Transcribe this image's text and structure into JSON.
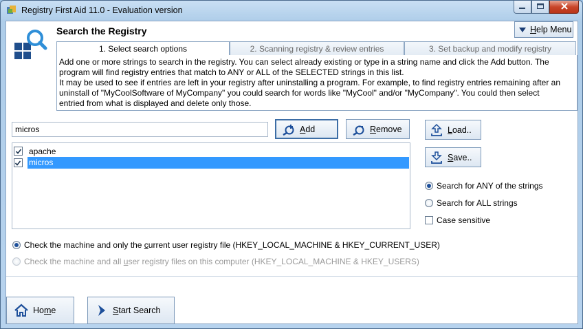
{
  "window": {
    "title": "Registry First Aid 11.0 - Evaluation version"
  },
  "header": {
    "title": "Search the Registry",
    "help_label": "Help Menu"
  },
  "tabs": [
    {
      "label": "1. Select search options"
    },
    {
      "label": "2. Scanning registry & review entries"
    },
    {
      "label": "3. Set backup and modify registry"
    }
  ],
  "description": {
    "lines": [
      "Add one or more strings to search in the registry. You can select already existing or type in a string name and click the Add button. The",
      "program will find registry entries that match to ANY or ALL of the SELECTED strings in this list.",
      "It may be used to see if entries are left in your registry after uninstalling a program. For example, to find registry entries remaining after an",
      "uninstall of \"MyCoolSoftware of MyCompany\" you could search for words like \"MyCool\" and/or \"MyCompany\". You could then select",
      "entried from what is displayed and delete only those."
    ]
  },
  "search": {
    "value": "micros"
  },
  "buttons": {
    "add": {
      "pre": "",
      "u": "A",
      "post": "dd"
    },
    "remove": {
      "pre": "",
      "u": "R",
      "post": "emove"
    },
    "load": {
      "pre": "",
      "u": "L",
      "post": "oad.."
    },
    "save": {
      "pre": "",
      "u": "S",
      "post": "ave.."
    },
    "home": {
      "pre": "Ho",
      "u": "m",
      "post": "e"
    },
    "start": {
      "pre": "",
      "u": "S",
      "post": "tart Search"
    }
  },
  "list": {
    "items": [
      {
        "label": "apache",
        "checked": true,
        "selected": false
      },
      {
        "label": "micros",
        "checked": true,
        "selected": true
      }
    ]
  },
  "options": {
    "any": "Search for ANY of the strings",
    "all": "Search for ALL strings",
    "case": "Case sensitive"
  },
  "scope": {
    "current": {
      "pre": "Check the machine and only the ",
      "u": "c",
      "post": "urrent user registry file (HKEY_LOCAL_MACHINE & HKEY_CURRENT_USER)"
    },
    "all": {
      "pre": "Check the machine and all ",
      "u": "u",
      "post": "ser registry files on this computer (HKEY_LOCAL_MACHINE & HKEY_USERS)"
    }
  },
  "colors": {
    "accent": "#1d4f9a",
    "selection": "#3399ff"
  }
}
